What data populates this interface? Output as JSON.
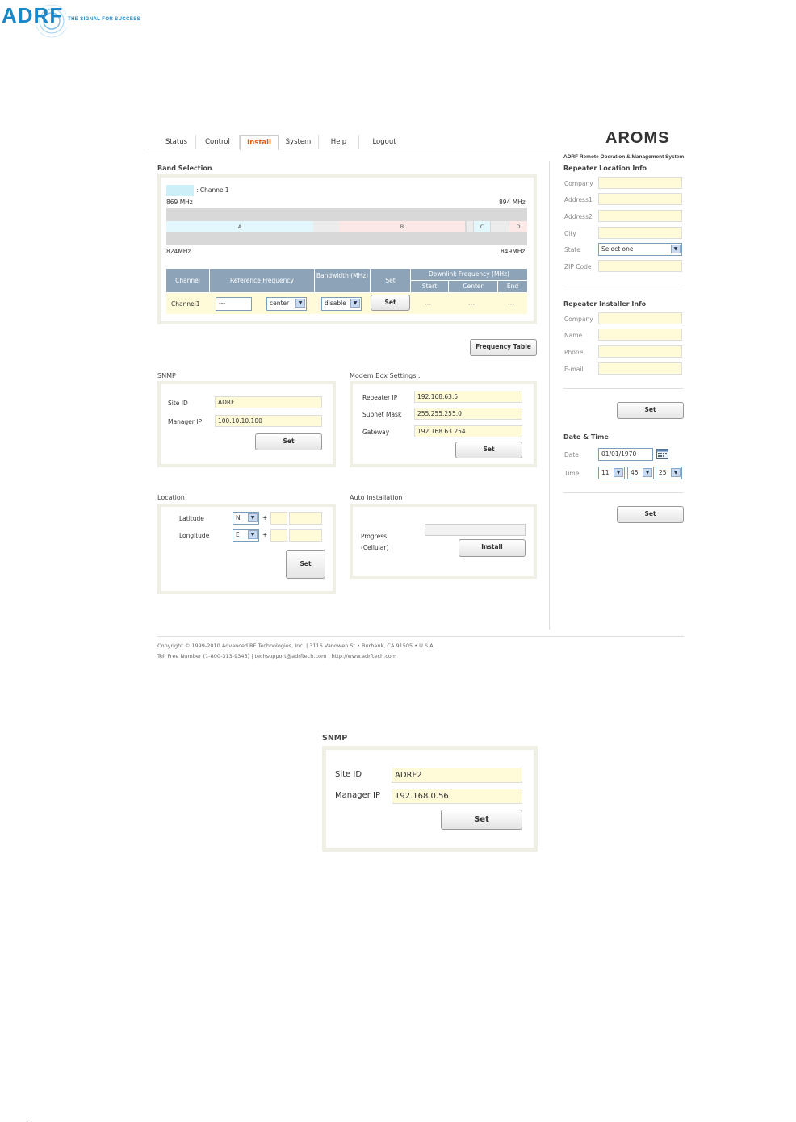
{
  "logo": {
    "text": "ADRF",
    "tagline": "THE SIGNAL FOR SUCCESS"
  },
  "nav": {
    "tabs": [
      {
        "label": "Status"
      },
      {
        "label": "Control"
      },
      {
        "label": "Install",
        "active": true
      },
      {
        "label": "System"
      },
      {
        "label": "Help"
      },
      {
        "label": "Logout"
      }
    ],
    "brand": "AROMS",
    "brand_subtitle": "ADRF Remote Operation & Management System"
  },
  "band_selection": {
    "title": "Band Selection",
    "legend_label": ": Channel1",
    "top_left_freq": "869 MHz",
    "top_right_freq": "894 MHz",
    "bottom_left_freq": "824MHz",
    "bottom_right_freq": "849MHz",
    "bands": [
      "A",
      "B",
      "C",
      "D"
    ],
    "table": {
      "headers": {
        "channel": "Channel",
        "reference_frequency": "Reference Frequency",
        "bandwidth": "Bandwidth (MHz)",
        "set": "Set",
        "downlink": "Downlink Frequency (MHz)",
        "start": "Start",
        "center": "Center",
        "end": "End"
      },
      "row": {
        "channel": "Channel1",
        "ref_value": "---",
        "ref_mode": "center",
        "bandwidth": "disable",
        "set_label": "Set",
        "start": "---",
        "center": "---",
        "end": "---"
      }
    },
    "frequency_table_button": "Frequency Table"
  },
  "snmp": {
    "title": "SNMP",
    "site_id_label": "Site ID",
    "site_id": "ADRF",
    "manager_ip_label": "Manager IP",
    "manager_ip": "100.10.10.100",
    "set_label": "Set"
  },
  "modem": {
    "title": "Modem Box Settings :",
    "repeater_ip_label": "Repeater IP",
    "repeater_ip": "192.168.63.5",
    "subnet_label": "Subnet Mask",
    "subnet": "255.255.255.0",
    "gateway_label": "Gateway",
    "gateway": "192.168.63.254",
    "set_label": "Set"
  },
  "location": {
    "title": "Location",
    "latitude_label": "Latitude",
    "latitude_dir": "N",
    "longitude_label": "Longitude",
    "longitude_dir": "E",
    "plus": "+",
    "set_label": "Set"
  },
  "auto_install": {
    "title": "Auto Installation",
    "progress_label": "Progress",
    "progress_sub": "(Cellular)",
    "progress_value": 0,
    "install_label": "Install"
  },
  "location_info": {
    "title": "Repeater Location Info",
    "company": "Company",
    "address1": "Address1",
    "address2": "Address2",
    "city": "City",
    "state": "State",
    "state_value": "Select one",
    "zip": "ZIP Code"
  },
  "installer_info": {
    "title": "Repeater Installer Info",
    "company": "Company",
    "name": "Name",
    "phone": "Phone",
    "email": "E-mail",
    "set_label": "Set"
  },
  "date_time": {
    "title": "Date & Time",
    "date_label": "Date",
    "date_value": "01/01/1970",
    "time_label": "Time",
    "hour": "11",
    "minute": "45",
    "second": "25",
    "set_label": "Set"
  },
  "footer": {
    "line1": "Copyright © 1999-2010 Advanced RF Technologies, Inc. | 3116 Vanowen St • Burbank, CA 91505 • U.S.A.",
    "line2": "Toll Free Number (1-800-313-9345) | techsupport@adrftech.com | http://www.adrftech.com"
  },
  "snmp_zoom": {
    "title": "SNMP",
    "site_id_label": "Site ID",
    "site_id": "ADRF2",
    "manager_ip_label": "Manager IP",
    "manager_ip": "192.168.0.56",
    "set_label": "Set"
  },
  "colors": {
    "accent": "#e05e1a",
    "table_header": "#8da4b8",
    "input_fill": "#fffbd8",
    "band_a": "#e3f8fc",
    "band_b": "#fde8e8",
    "logo": "#1b86c8"
  }
}
